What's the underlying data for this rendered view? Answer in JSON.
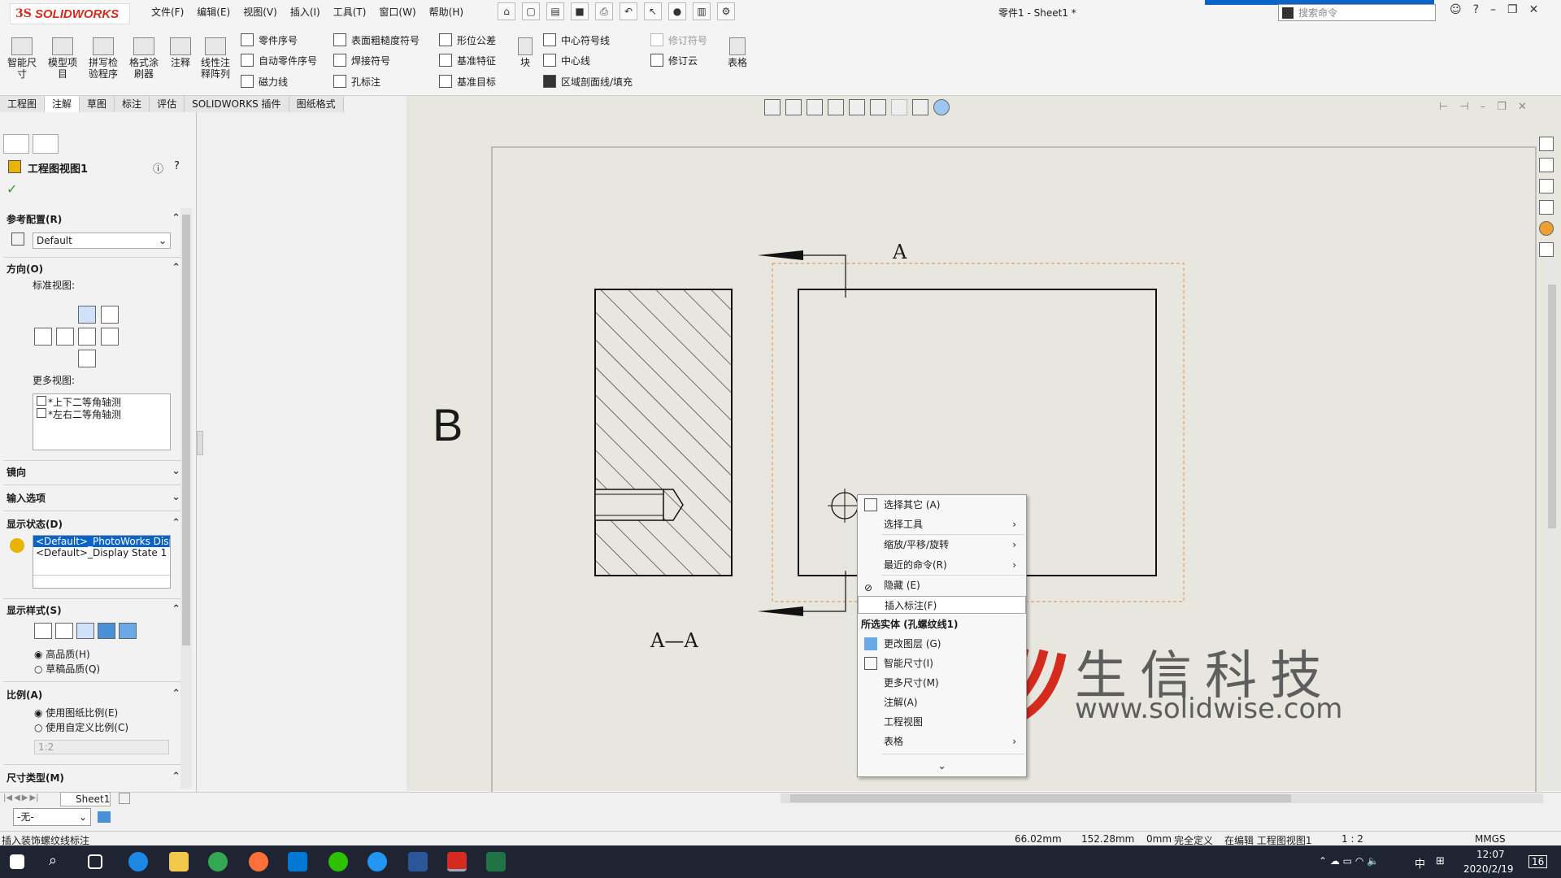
{
  "app": {
    "brand_ds": "3S",
    "brand": "SOLIDWORKS",
    "doc_title": "零件1 - Sheet1 *"
  },
  "menu": [
    "文件(F)",
    "编辑(E)",
    "视图(V)",
    "插入(I)",
    "工具(T)",
    "窗口(W)",
    "帮助(H)"
  ],
  "search": {
    "placeholder": "搜索命令"
  },
  "ribbon": {
    "big": [
      "智能尺寸",
      "模型项目",
      "拼写检验程序",
      "格式涂刷器",
      "注释",
      "线性注释阵列"
    ],
    "col1": [
      "零件序号",
      "自动零件序号",
      "磁力线"
    ],
    "col2": [
      "表面粗糙度符号",
      "焊接符号",
      "孔标注"
    ],
    "col3": [
      "形位公差",
      "基准特征",
      "基准目标"
    ],
    "block": "块",
    "col4": [
      "中心符号线",
      "中心线",
      "区域剖面线/填充"
    ],
    "col5": [
      "修订符号",
      "修订云"
    ],
    "table": "表格"
  },
  "tabs": [
    "工程图",
    "注解",
    "草图",
    "标注",
    "评估",
    "SOLIDWORKS 插件",
    "图纸格式"
  ],
  "panel": {
    "title": "工程图视图1",
    "ref_config": "参考配置(R)",
    "config_value": "Default",
    "orientation": "方向(O)",
    "std_views": "标准视图:",
    "more_views": "更多视图:",
    "more_items": [
      "*上下二等角轴测",
      "*左右二等角轴测"
    ],
    "mirror": "镜向",
    "import": "输入选项",
    "display_state": "显示状态(D)",
    "states": [
      "<Default>_PhotoWorks Display",
      "<Default>_Display State 1"
    ],
    "display_style": "显示样式(S)",
    "hq": "高品质(H)",
    "draft": "草稿品质(Q)",
    "scale": "比例(A)",
    "use_sheet": "使用图纸比例(E)",
    "use_custom": "使用自定义比例(C)",
    "scale_value": "1:2",
    "dim_type": "尺寸类型(M)"
  },
  "drawing": {
    "label_a": "A",
    "label_b": "B",
    "label_aa": "A—A"
  },
  "context_menu": {
    "items": [
      "选择其它 (A)",
      "选择工具",
      "缩放/平移/旋转",
      "最近的命令(R)",
      "隐藏 (E)",
      "插入标注(F)"
    ],
    "section": "所选实体 (孔螺纹线1)",
    "items2": [
      "更改图层 (G)",
      "智能尺寸(I)",
      "更多尺寸(M)",
      "注解(A)",
      "工程视图",
      "表格"
    ],
    "expand": "⌄"
  },
  "watermark": {
    "text": "生信科技",
    "url": "www.solidwise.com"
  },
  "bottom": {
    "sheet": "Sheet1",
    "layer": "-无-"
  },
  "status": {
    "hint": "插入装饰螺纹线标注",
    "x": "66.02mm",
    "y": "152.28mm",
    "z": "0mm",
    "state": "完全定义",
    "editing": "在编辑 工程图视图1",
    "scale": "1 : 2",
    "units": "MMGS"
  },
  "taskbar": {
    "time": "12:07",
    "date": "2020/2/19",
    "lang": "中",
    "notif": "16"
  }
}
